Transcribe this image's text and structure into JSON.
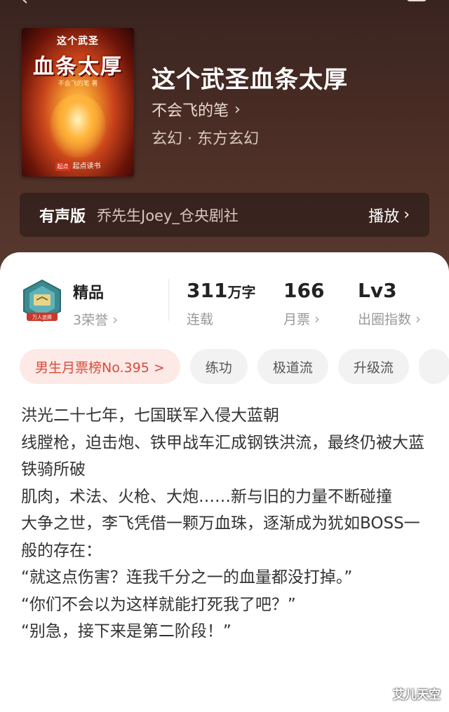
{
  "header": {
    "back_glyph": "‹",
    "cover": {
      "small_title": "这个武圣",
      "big_title": "血条太厚",
      "author_line": "不会飞的笔 著",
      "brand_badge": "起点",
      "brand_name": "起点读书"
    },
    "title": "这个武圣血条太厚",
    "author": "不会飞的笔",
    "genre": "玄幻 · 东方玄幻",
    "audio": {
      "label": "有声版",
      "narrator": "乔先生Joey_仓央剧社",
      "play_label": "播放"
    }
  },
  "stats": {
    "quality": {
      "main": "精品",
      "sub": "3荣誉",
      "badge_text": "万人追捧"
    },
    "words": {
      "num": "311",
      "unit": "万字",
      "sub": "连载"
    },
    "votes": {
      "num": "166",
      "sub": "月票"
    },
    "level": {
      "num": "Lv3",
      "sub": "出圈指数"
    }
  },
  "tags": [
    "男生月票榜No.395 >",
    "练功",
    "极道流",
    "升级流"
  ],
  "synopsis": [
    "洪光二十七年，七国联军入侵大蓝朝",
    "线膛枪，迫击炮、铁甲战车汇成钢铁洪流，最终仍被大蓝铁骑所破",
    "肌肉，术法、火枪、大炮……新与旧的力量不断碰撞",
    "大争之世，李飞凭借一颗万血珠，逐渐成为犹如BOSS一般的存在：",
    "“就这点伤害？连我千分之一的血量都没打掉。”",
    "“你们不会以为这样就能打死我了吧？”",
    "“别急，接下来是第二阶段！”"
  ],
  "watermark": "艾儿天空",
  "colors": {
    "header_bg": "#4a2d25",
    "rank_tag_bg": "#fde9e6",
    "rank_tag_text": "#d94a3a",
    "badge_teal": "#3a8a8f"
  }
}
